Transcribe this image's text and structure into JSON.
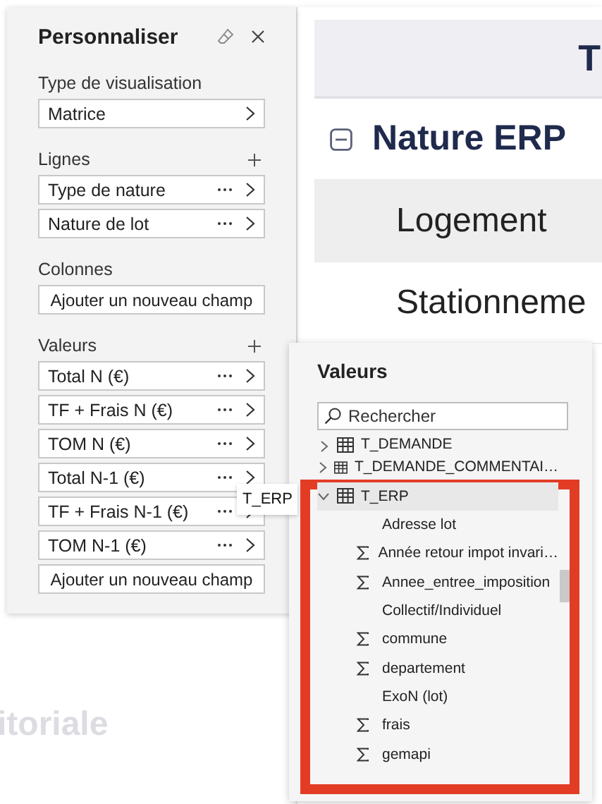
{
  "matrix": {
    "header": "T",
    "rows": [
      {
        "label": "Nature ERP",
        "kind": "group",
        "expanded": true
      },
      {
        "label": "Logement",
        "kind": "item"
      },
      {
        "label": "Stationneme",
        "kind": "item"
      }
    ],
    "faded_title": "itoriale"
  },
  "panel": {
    "title": "Personnaliser",
    "sections": [
      {
        "label": "Type de visualisation",
        "addable": false,
        "fields": [
          {
            "label": "Matrice",
            "kind": "select"
          }
        ]
      },
      {
        "label": "Lignes",
        "addable": true,
        "fields": [
          {
            "label": "Type de nature",
            "kind": "field"
          },
          {
            "label": "Nature de lot",
            "kind": "field"
          }
        ]
      },
      {
        "label": "Colonnes",
        "addable": false,
        "fields": [
          {
            "label": "Ajouter un nouveau champ",
            "kind": "add"
          }
        ]
      },
      {
        "label": "Valeurs",
        "addable": true,
        "fields": [
          {
            "label": "Total N (€)",
            "kind": "field"
          },
          {
            "label": "TF + Frais N (€)",
            "kind": "field"
          },
          {
            "label": "TOM N (€)",
            "kind": "field"
          },
          {
            "label": "Total N-1 (€)",
            "kind": "field"
          },
          {
            "label": "TF + Frais N-1 (€)",
            "kind": "field"
          },
          {
            "label": "TOM N-1 (€)",
            "kind": "field"
          },
          {
            "label": "Ajouter un nouveau champ",
            "kind": "add"
          }
        ]
      }
    ]
  },
  "tooltip": "T_ERP",
  "popup": {
    "title": "Valeurs",
    "search": {
      "placeholder": "Rechercher"
    },
    "highlight_frame": true,
    "tree": [
      {
        "label": "T_DEMANDE",
        "expanded": false,
        "selected": false
      },
      {
        "label": "T_DEMANDE_COMMENTAI…",
        "expanded": false,
        "selected": false
      },
      {
        "label": "T_ERP",
        "expanded": true,
        "selected": true,
        "children": [
          {
            "label": "Adresse lot",
            "kind": "text"
          },
          {
            "label": "Année retour impot invari…",
            "kind": "numeric"
          },
          {
            "label": "Annee_entree_imposition",
            "kind": "numeric"
          },
          {
            "label": "Collectif/Individuel",
            "kind": "text"
          },
          {
            "label": "commune",
            "kind": "numeric"
          },
          {
            "label": "departement",
            "kind": "numeric"
          },
          {
            "label": "ExoN (lot)",
            "kind": "text"
          },
          {
            "label": "frais",
            "kind": "numeric"
          },
          {
            "label": "gemapi",
            "kind": "numeric"
          }
        ]
      }
    ]
  }
}
